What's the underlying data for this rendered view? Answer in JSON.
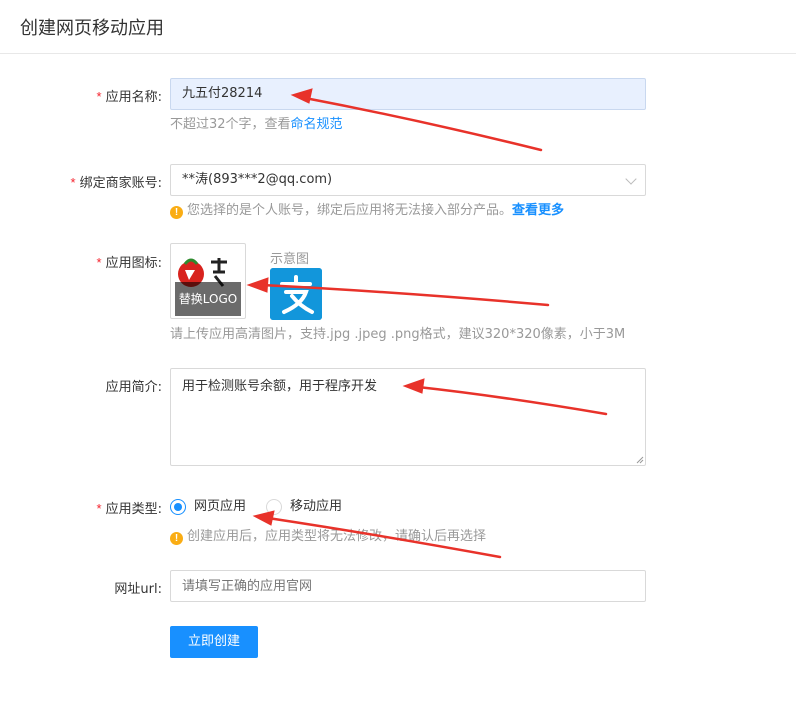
{
  "header": {
    "title": "创建网页移动应用"
  },
  "form": {
    "app_name": {
      "label": "应用名称:",
      "value": "九五付28214",
      "hint_prefix": "不超过32个字，查看",
      "hint_link": "命名规范"
    },
    "merchant_account": {
      "label": "绑定商家账号:",
      "value": "**涛(893***2@qq.com)",
      "hint": "您选择的是个人账号，绑定后应用将无法接入部分产品。",
      "hint_link": "查看更多"
    },
    "app_icon": {
      "label": "应用图标:",
      "replace_text": "替换LOGO",
      "sample_label": "示意图",
      "hint": "请上传应用高清图片，支持.jpg .jpeg .png格式，建议320*320像素，小于3M"
    },
    "app_intro": {
      "label": "应用简介:",
      "value": "用于检测账号余额，用于程序开发"
    },
    "app_type": {
      "label": "应用类型:",
      "options": [
        "网页应用",
        "移动应用"
      ],
      "selected": "网页应用",
      "hint": "创建应用后，应用类型将无法修改，请确认后再选择"
    },
    "url": {
      "label": "网址url:",
      "placeholder": "请填写正确的应用官网"
    },
    "required_mark": "*",
    "submit_label": "立即创建"
  },
  "icons": {
    "warning": "exclamation-circle-icon",
    "select_arrow": "chevron-down-icon",
    "sample_app": "alipay-icon"
  },
  "colors": {
    "primary": "#1890ff",
    "required": "#f5222d",
    "warning": "#faad14",
    "annotation_arrow": "#e8322a",
    "filled_input_bg": "#e8f0fe"
  }
}
